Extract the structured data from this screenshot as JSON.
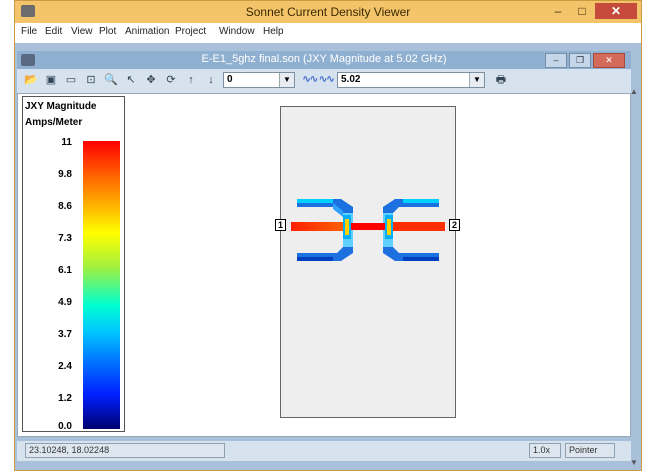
{
  "window": {
    "title": "Sonnet Current Density Viewer",
    "min": "–",
    "max": "□",
    "close": "✕"
  },
  "menu": [
    "File",
    "Edit",
    "View",
    "Plot",
    "Animation",
    "Project",
    "Window",
    "Help"
  ],
  "document": {
    "title": "E-E1_5ghz final.son (JXY Magnitude at 5.02 GHz)"
  },
  "toolbar": {
    "level_value": "0",
    "frequency_value": "5.02",
    "wave_icon_label": "∿∿ ∿∿"
  },
  "legend": {
    "title": "JXY Magnitude",
    "units": "Amps/Meter",
    "ticks": [
      "11",
      "9.8",
      "8.6",
      "7.3",
      "6.1",
      "4.9",
      "3.7",
      "2.4",
      "1.2",
      "0.0"
    ],
    "colors": {
      "max": "#ff0000",
      "min": "#000070"
    }
  },
  "ports": {
    "left": "1",
    "right": "2"
  },
  "status": {
    "coords": "23.10248, 18.02248",
    "zoom": "1.0x",
    "mode": "Pointer"
  }
}
